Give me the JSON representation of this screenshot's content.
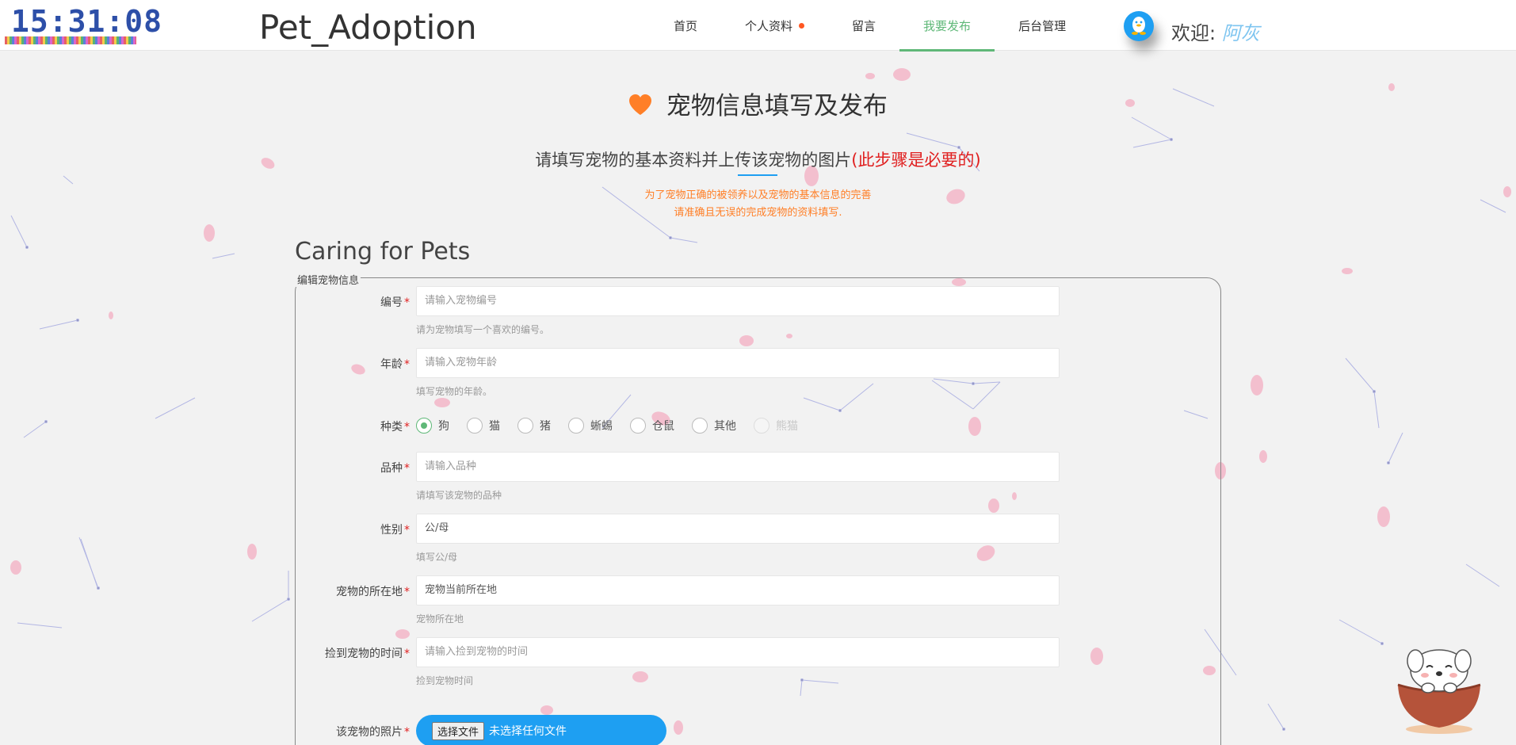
{
  "header": {
    "clock": "15:31:08",
    "site_title": "Pet_Adoption",
    "nav": [
      {
        "label": "首页",
        "active": false,
        "badge": false
      },
      {
        "label": "个人资料",
        "active": false,
        "badge": true
      },
      {
        "label": "留言",
        "active": false,
        "badge": false
      },
      {
        "label": "我要发布",
        "active": true,
        "badge": false
      },
      {
        "label": "后台管理",
        "active": false,
        "badge": false
      }
    ],
    "welcome_label": "欢迎:",
    "welcome_name": "阿灰"
  },
  "heading": {
    "title": "宠物信息填写及发布",
    "subtitle": "请填写宠物的基本资料并上传该宠物的图片",
    "subtitle_required": "(此步骤是必要的)",
    "note_line1": "为了宠物正确的被领养以及宠物的基本信息的完善",
    "note_line2": "请准确且无误的完成宠物的资料填写."
  },
  "form": {
    "section_title": "Caring for Pets",
    "legend": "编辑宠物信息",
    "required_mark": "*",
    "fields": {
      "number": {
        "label": "编号",
        "placeholder": "请输入宠物编号",
        "hint": "请为宠物填写一个喜欢的编号。"
      },
      "age": {
        "label": "年龄",
        "placeholder": "请输入宠物年龄",
        "hint": "填写宠物的年龄。"
      },
      "species": {
        "label": "种类",
        "options": [
          {
            "label": "狗",
            "checked": true,
            "disabled": false
          },
          {
            "label": "猫",
            "checked": false,
            "disabled": false
          },
          {
            "label": "猪",
            "checked": false,
            "disabled": false
          },
          {
            "label": "蜥蜴",
            "checked": false,
            "disabled": false
          },
          {
            "label": "仓鼠",
            "checked": false,
            "disabled": false
          },
          {
            "label": "其他",
            "checked": false,
            "disabled": false
          },
          {
            "label": "熊猫",
            "checked": false,
            "disabled": true
          }
        ]
      },
      "breed": {
        "label": "品种",
        "placeholder": "请输入品种",
        "hint": "请填写该宠物的品种"
      },
      "gender": {
        "label": "性别",
        "placeholder": "公/母",
        "hint": "填写公/母"
      },
      "location": {
        "label": "宠物的所在地",
        "placeholder": "宠物当前所在地",
        "hint": "宠物所在地"
      },
      "found_time": {
        "label": "捡到宠物的时间",
        "placeholder": "请输入捡到宠物的时间",
        "hint": "捡到宠物时间"
      },
      "photo": {
        "label": "该宠物的照片",
        "button": "选择文件",
        "status": "未选择任何文件"
      }
    }
  },
  "colors": {
    "accent_green": "#5FB878",
    "accent_blue": "#1e9ff2",
    "required_red": "#e02020",
    "note_orange": "#ff7f27",
    "heart_orange": "#ff7f27"
  }
}
